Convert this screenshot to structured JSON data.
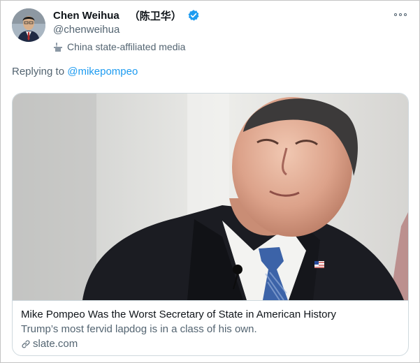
{
  "author": {
    "display_name": "Chen Weihua",
    "cn_name": "（陈卫华）",
    "handle": "@chenweihua",
    "label": "China state-affiliated media"
  },
  "reply": {
    "prefix": "Replying to ",
    "mention": "@mikepompeo"
  },
  "card": {
    "title": "Mike Pompeo Was the Worst Secretary of State in American History",
    "description": "Trump’s most fervid lapdog is in a class of his own.",
    "domain": "slate.com"
  },
  "icons": {
    "verified": "verified-badge-icon",
    "affiliation": "state-media-podium-icon",
    "more": "more-options-icon",
    "link": "link-icon"
  },
  "colors": {
    "accent": "#1d9bf0",
    "secondary_text": "#536471",
    "primary_text": "#0f1419"
  }
}
